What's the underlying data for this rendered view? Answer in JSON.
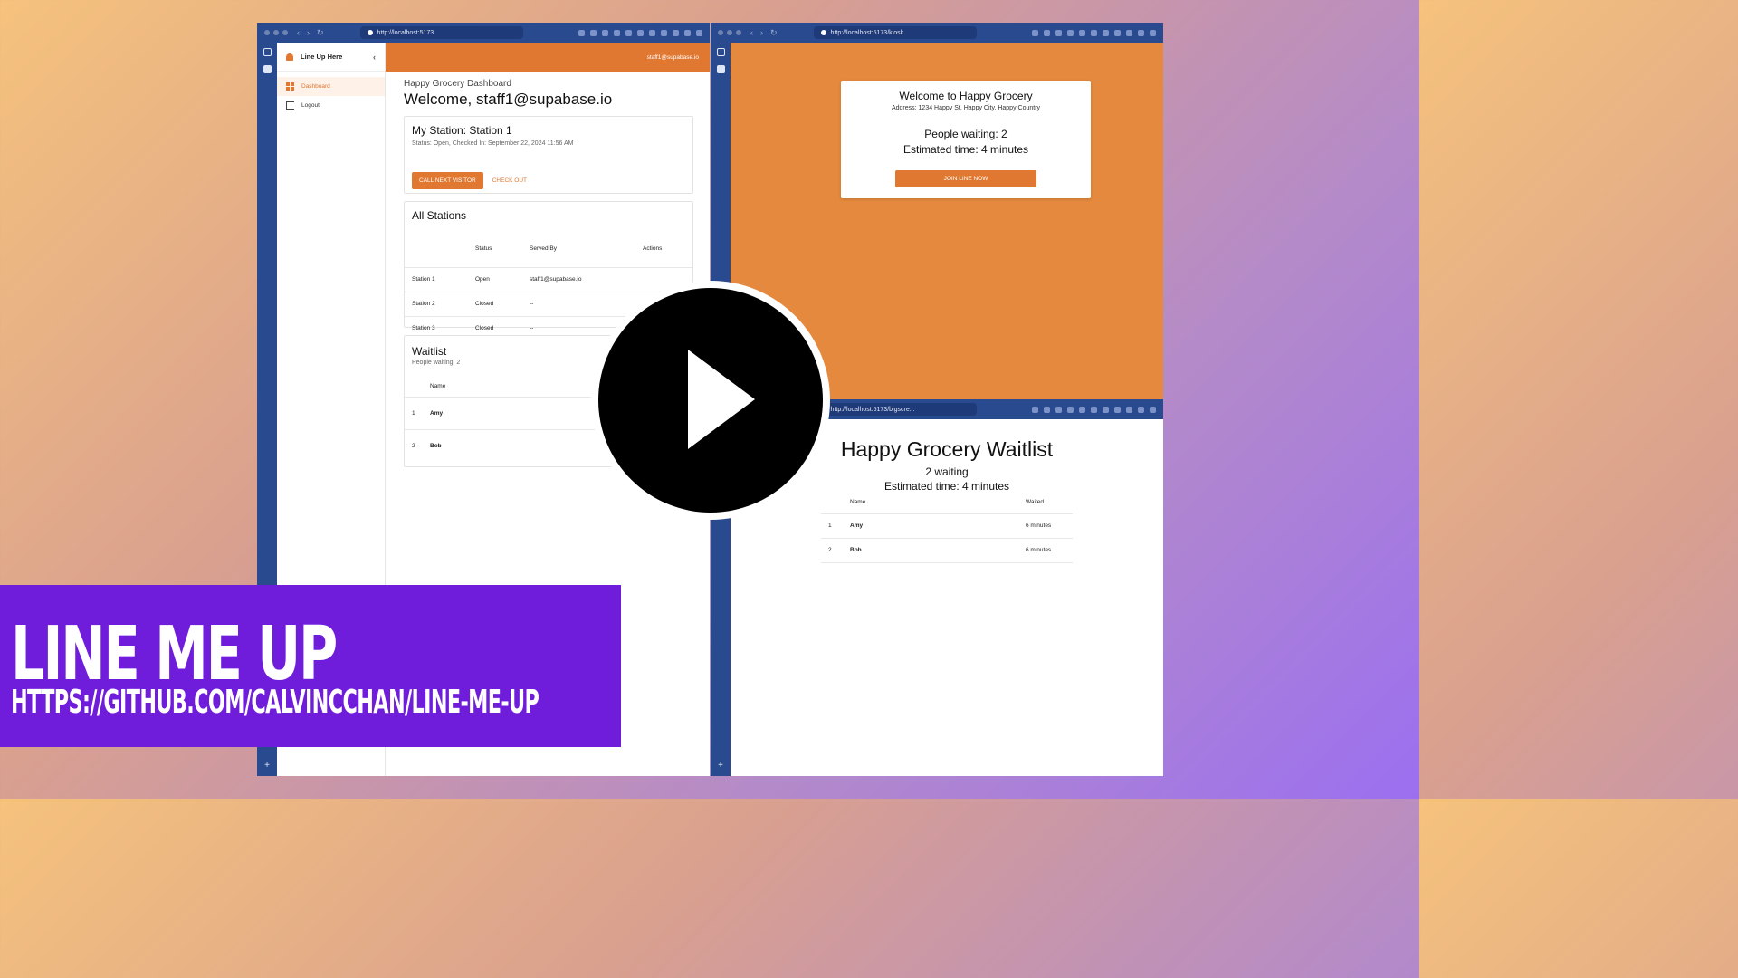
{
  "left_window": {
    "url": "http://localhost:5173",
    "app_name": "Line Up Here",
    "user_email": "staff1@supabase.io",
    "nav": [
      {
        "label": "Dashboard"
      },
      {
        "label": "Logout"
      }
    ],
    "dashboard_title": "Happy Grocery Dashboard",
    "welcome": "Welcome, staff1@supabase.io",
    "my_station": {
      "title": "My Station: Station 1",
      "status": "Status: Open, Checked In: September 22, 2024 11:56 AM",
      "call_next_label": "CALL NEXT VISITOR",
      "check_out_label": "CHECK OUT"
    },
    "all_stations": {
      "title": "All Stations",
      "headers": [
        "Status",
        "Served By",
        "Actions"
      ],
      "rows": [
        {
          "name": "Station 1",
          "status": "Open",
          "served_by": "staff1@supabase.io"
        },
        {
          "name": "Station 2",
          "status": "Closed",
          "served_by": "--"
        },
        {
          "name": "Station 3",
          "status": "Closed",
          "served_by": "--"
        }
      ]
    },
    "waitlist": {
      "title": "Waitlist",
      "people_waiting": "People waiting: 2",
      "header_name": "Name",
      "rows": [
        {
          "num": "1",
          "name": "Amy"
        },
        {
          "num": "2",
          "name": "Bob"
        }
      ]
    }
  },
  "kiosk_window": {
    "url": "http://localhost:5173/kiosk",
    "title": "Welcome to Happy Grocery",
    "address": "Address: 1234 Happy St, Happy City, Happy Country",
    "people_waiting": "People waiting: 2",
    "estimated": "Estimated time: 4 minutes",
    "join_label": "JOIN LINE NOW"
  },
  "bigscreen_window": {
    "url": "http://localhost:5173/bigscre...",
    "title": "Happy Grocery Waitlist",
    "waiting": "2 waiting",
    "estimated": "Estimated time: 4 minutes",
    "header_name": "Name",
    "header_waited": "Waited",
    "rows": [
      {
        "num": "1",
        "name": "Amy",
        "waited": "6 minutes"
      },
      {
        "num": "2",
        "name": "Bob",
        "waited": "6 minutes"
      }
    ]
  },
  "banner": {
    "title": "LINE ME UP",
    "url": "HTTPS://GITHUB.COM/CALVINCCHAN/LINE-ME-UP"
  },
  "colors": {
    "accent": "#e07832",
    "browser_chrome": "#2a4a8f",
    "banner": "#6f1ddb"
  }
}
